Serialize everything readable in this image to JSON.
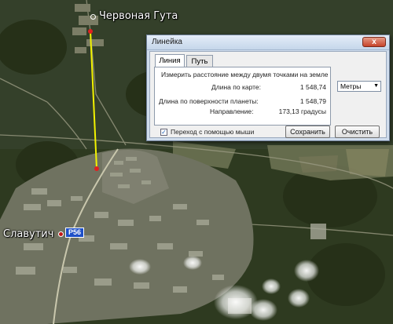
{
  "places": [
    {
      "name": "Червоная Гута"
    },
    {
      "name": "Славутич"
    }
  ],
  "road_shield": "P56",
  "ruler": {
    "title": "Линейка",
    "close_label": "x",
    "tabs": [
      {
        "label": "Линия",
        "active": true
      },
      {
        "label": "Путь",
        "active": false
      }
    ],
    "instruction": "Измерить расстояние между двумя точками на земле",
    "map_length_label": "Длина по карте:",
    "map_length_value": "1 548,74",
    "unit_selected": "Метры",
    "surface_length_label": "Длина по поверхности планеты:",
    "surface_length_value": "1 548,79",
    "direction_label": "Направление:",
    "direction_value": "173,13 градусы",
    "mouse_nav_label": "Переход с помощью мыши",
    "mouse_nav_checked": true,
    "save_label": "Сохранить",
    "clear_label": "Очистить"
  },
  "colors": {
    "measure_line": "#f2f200",
    "endpoint": "#e02020",
    "place_dot": "#c01818"
  }
}
